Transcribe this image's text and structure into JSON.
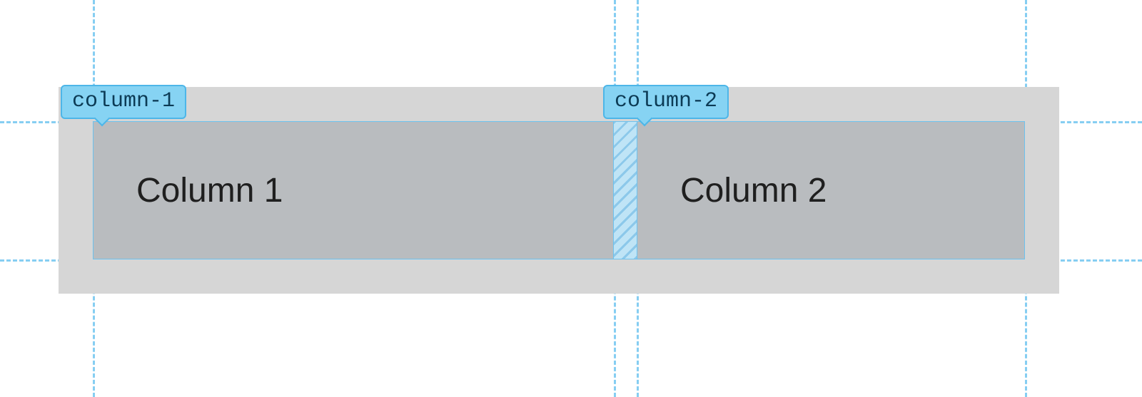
{
  "labels": {
    "col1_tag": "column-1",
    "col2_tag": "column-2"
  },
  "columns": {
    "col1_text": "Column 1",
    "col2_text": "Column 2"
  },
  "guides": {
    "horizontal": [
      170,
      364
    ],
    "vertical": [
      130,
      860,
      892,
      1436
    ]
  }
}
